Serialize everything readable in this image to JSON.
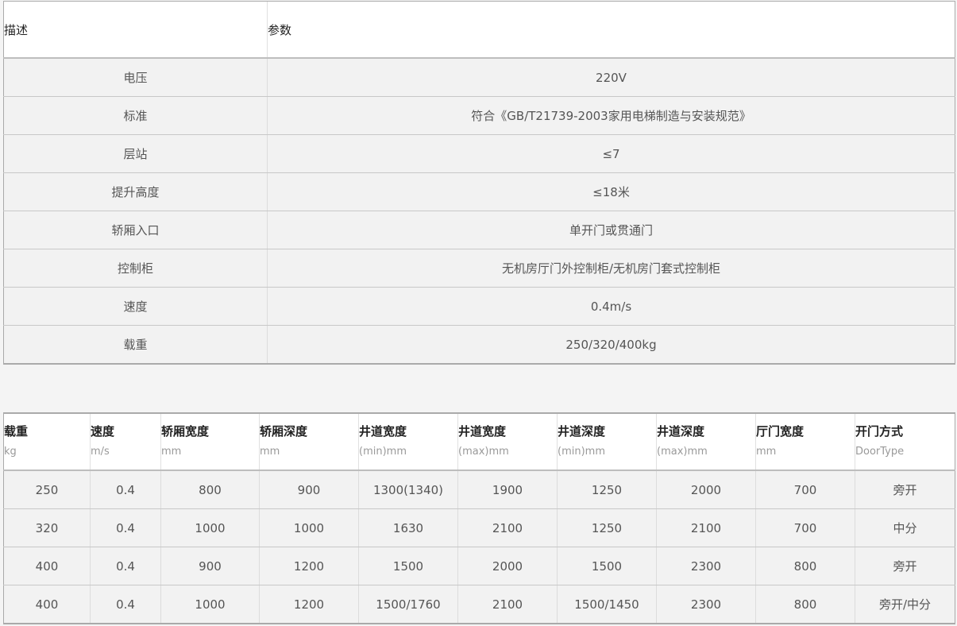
{
  "spec_table": {
    "header": {
      "description": "描述",
      "parameter": "参数"
    },
    "rows": [
      {
        "label": "电压",
        "value": "220V"
      },
      {
        "label": "标准",
        "value": "符合《GB/T21739-2003家用电梯制造与安装规范》"
      },
      {
        "label": "层站",
        "value": "≤7"
      },
      {
        "label": "提升高度",
        "value": "≤18米"
      },
      {
        "label": "轿厢入口",
        "value": "单开门或贯通门"
      },
      {
        "label": "控制柜",
        "value": "无机房厅门外控制柜/无机房门套式控制柜"
      },
      {
        "label": "速度",
        "value": "0.4m/s"
      },
      {
        "label": "载重",
        "value": "250/320/400kg"
      }
    ]
  },
  "model_table": {
    "columns": [
      {
        "title": "载重",
        "unit": "kg"
      },
      {
        "title": "速度",
        "unit": "m/s"
      },
      {
        "title": "轿厢宽度",
        "unit": "mm"
      },
      {
        "title": "轿厢深度",
        "unit": "mm"
      },
      {
        "title": "井道宽度",
        "unit": "(min)mm"
      },
      {
        "title": "井道宽度",
        "unit": "(max)mm"
      },
      {
        "title": "井道深度",
        "unit": "(min)mm"
      },
      {
        "title": "井道深度",
        "unit": "(max)mm"
      },
      {
        "title": "厅门宽度",
        "unit": "mm"
      },
      {
        "title": "开门方式",
        "unit": "DoorType"
      }
    ],
    "rows": [
      [
        "250",
        "0.4",
        "800",
        "900",
        "1300(1340)",
        "1900",
        "1250",
        "2000",
        "700",
        "旁开"
      ],
      [
        "320",
        "0.4",
        "1000",
        "1000",
        "1630",
        "2100",
        "1250",
        "2100",
        "700",
        "中分"
      ],
      [
        "400",
        "0.4",
        "900",
        "1200",
        "1500",
        "2000",
        "1500",
        "2300",
        "800",
        "旁开"
      ],
      [
        "400",
        "0.4",
        "1000",
        "1200",
        "1500/1760",
        "2100",
        "1500/1450",
        "2300",
        "800",
        "旁开/中分"
      ]
    ]
  }
}
